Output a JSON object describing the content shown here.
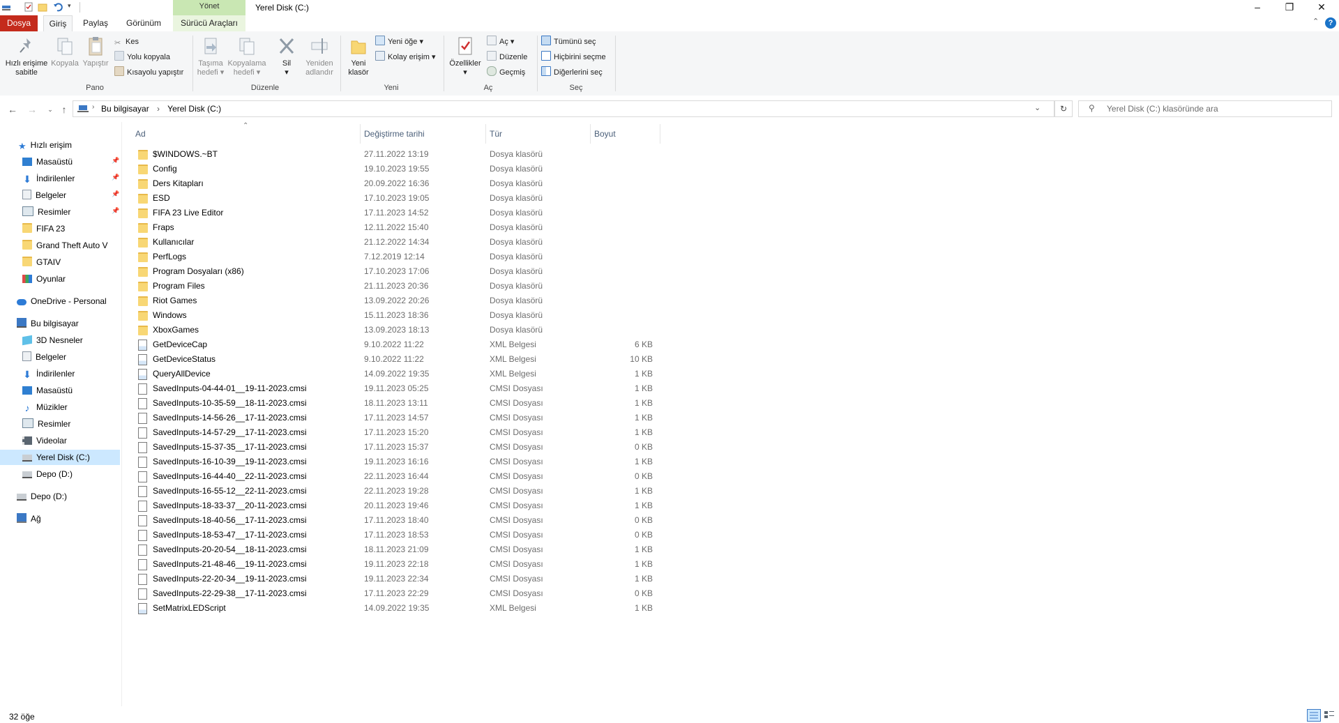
{
  "window": {
    "title": "Yerel Disk (C:)",
    "context_tab_group": "Yönet"
  },
  "tabs": {
    "file": "Dosya",
    "home": "Giriş",
    "share": "Paylaş",
    "view": "Görünüm",
    "drive_tools": "Sürücü Araçları"
  },
  "ribbon": {
    "clipboard": {
      "pin": "Hızlı erişime sabitle",
      "copy": "Kopyala",
      "paste": "Yapıştır",
      "cut": "Kes",
      "copy_path": "Yolu kopyala",
      "paste_shortcut": "Kısayolu yapıştır",
      "label": "Pano"
    },
    "organize": {
      "move_to": "Taşıma hedefi",
      "copy_to": "Kopyalama hedefi",
      "delete": "Sil",
      "rename": "Yeniden adlandır",
      "label": "Düzenle"
    },
    "new": {
      "new_folder": "Yeni klasör",
      "new_item": "Yeni öğe",
      "easy_access": "Kolay erişim",
      "label": "Yeni"
    },
    "open": {
      "properties": "Özellikler",
      "open": "Aç",
      "edit": "Düzenle",
      "history": "Geçmiş",
      "label": "Aç"
    },
    "select": {
      "select_all": "Tümünü seç",
      "select_none": "Hiçbirini seçme",
      "invert": "Diğerlerini seç",
      "label": "Seç"
    }
  },
  "address": {
    "crumb1": "Bu bilgisayar",
    "crumb2": "Yerel Disk (C:)",
    "search_placeholder": "Yerel Disk (C:) klasöründe ara"
  },
  "sidebar": {
    "quick_access": "Hızlı erişim",
    "quick_items": [
      "Masaüstü",
      "İndirilenler",
      "Belgeler",
      "Resimler",
      "FIFA 23",
      "Grand Theft Auto V",
      "GTAIV",
      "Oyunlar"
    ],
    "onedrive": "OneDrive - Personal",
    "this_pc": "Bu bilgisayar",
    "pc_items": [
      "3D Nesneler",
      "Belgeler",
      "İndirilenler",
      "Masaüstü",
      "Müzikler",
      "Resimler",
      "Videolar",
      "Yerel Disk (C:)",
      "Depo (D:)"
    ],
    "depo": "Depo (D:)",
    "network": "Ağ"
  },
  "columns": {
    "name": "Ad",
    "modified": "Değiştirme tarihi",
    "type": "Tür",
    "size": "Boyut"
  },
  "files": [
    {
      "name": "$WINDOWS.~BT",
      "date": "27.11.2022 13:19",
      "type": "Dosya klasörü",
      "size": "",
      "kind": "folder"
    },
    {
      "name": "Config",
      "date": "19.10.2023 19:55",
      "type": "Dosya klasörü",
      "size": "",
      "kind": "folder"
    },
    {
      "name": "Ders Kitapları",
      "date": "20.09.2022 16:36",
      "type": "Dosya klasörü",
      "size": "",
      "kind": "folder"
    },
    {
      "name": "ESD",
      "date": "17.10.2023 19:05",
      "type": "Dosya klasörü",
      "size": "",
      "kind": "folder"
    },
    {
      "name": "FIFA 23 Live Editor",
      "date": "17.11.2023 14:52",
      "type": "Dosya klasörü",
      "size": "",
      "kind": "folder"
    },
    {
      "name": "Fraps",
      "date": "12.11.2022 15:40",
      "type": "Dosya klasörü",
      "size": "",
      "kind": "folder"
    },
    {
      "name": "Kullanıcılar",
      "date": "21.12.2022 14:34",
      "type": "Dosya klasörü",
      "size": "",
      "kind": "folder"
    },
    {
      "name": "PerfLogs",
      "date": "7.12.2019 12:14",
      "type": "Dosya klasörü",
      "size": "",
      "kind": "folder"
    },
    {
      "name": "Program Dosyaları (x86)",
      "date": "17.10.2023 17:06",
      "type": "Dosya klasörü",
      "size": "",
      "kind": "folder"
    },
    {
      "name": "Program Files",
      "date": "21.11.2023 20:36",
      "type": "Dosya klasörü",
      "size": "",
      "kind": "folder"
    },
    {
      "name": "Riot Games",
      "date": "13.09.2022 20:26",
      "type": "Dosya klasörü",
      "size": "",
      "kind": "folder"
    },
    {
      "name": "Windows",
      "date": "15.11.2023 18:36",
      "type": "Dosya klasörü",
      "size": "",
      "kind": "folder"
    },
    {
      "name": "XboxGames",
      "date": "13.09.2023 18:13",
      "type": "Dosya klasörü",
      "size": "",
      "kind": "folder"
    },
    {
      "name": "GetDeviceCap",
      "date": "9.10.2022 11:22",
      "type": "XML Belgesi",
      "size": "6 KB",
      "kind": "xml"
    },
    {
      "name": "GetDeviceStatus",
      "date": "9.10.2022 11:22",
      "type": "XML Belgesi",
      "size": "10 KB",
      "kind": "xml"
    },
    {
      "name": "QueryAllDevice",
      "date": "14.09.2022 19:35",
      "type": "XML Belgesi",
      "size": "1 KB",
      "kind": "xml"
    },
    {
      "name": "SavedInputs-04-44-01__19-11-2023.cmsi",
      "date": "19.11.2023 05:25",
      "type": "CMSI Dosyası",
      "size": "1 KB",
      "kind": "doc"
    },
    {
      "name": "SavedInputs-10-35-59__18-11-2023.cmsi",
      "date": "18.11.2023 13:11",
      "type": "CMSI Dosyası",
      "size": "1 KB",
      "kind": "doc"
    },
    {
      "name": "SavedInputs-14-56-26__17-11-2023.cmsi",
      "date": "17.11.2023 14:57",
      "type": "CMSI Dosyası",
      "size": "1 KB",
      "kind": "doc"
    },
    {
      "name": "SavedInputs-14-57-29__17-11-2023.cmsi",
      "date": "17.11.2023 15:20",
      "type": "CMSI Dosyası",
      "size": "1 KB",
      "kind": "doc"
    },
    {
      "name": "SavedInputs-15-37-35__17-11-2023.cmsi",
      "date": "17.11.2023 15:37",
      "type": "CMSI Dosyası",
      "size": "0 KB",
      "kind": "doc"
    },
    {
      "name": "SavedInputs-16-10-39__19-11-2023.cmsi",
      "date": "19.11.2023 16:16",
      "type": "CMSI Dosyası",
      "size": "1 KB",
      "kind": "doc"
    },
    {
      "name": "SavedInputs-16-44-40__22-11-2023.cmsi",
      "date": "22.11.2023 16:44",
      "type": "CMSI Dosyası",
      "size": "0 KB",
      "kind": "doc"
    },
    {
      "name": "SavedInputs-16-55-12__22-11-2023.cmsi",
      "date": "22.11.2023 19:28",
      "type": "CMSI Dosyası",
      "size": "1 KB",
      "kind": "doc"
    },
    {
      "name": "SavedInputs-18-33-37__20-11-2023.cmsi",
      "date": "20.11.2023 19:46",
      "type": "CMSI Dosyası",
      "size": "1 KB",
      "kind": "doc"
    },
    {
      "name": "SavedInputs-18-40-56__17-11-2023.cmsi",
      "date": "17.11.2023 18:40",
      "type": "CMSI Dosyası",
      "size": "0 KB",
      "kind": "doc"
    },
    {
      "name": "SavedInputs-18-53-47__17-11-2023.cmsi",
      "date": "17.11.2023 18:53",
      "type": "CMSI Dosyası",
      "size": "0 KB",
      "kind": "doc"
    },
    {
      "name": "SavedInputs-20-20-54__18-11-2023.cmsi",
      "date": "18.11.2023 21:09",
      "type": "CMSI Dosyası",
      "size": "1 KB",
      "kind": "doc"
    },
    {
      "name": "SavedInputs-21-48-46__19-11-2023.cmsi",
      "date": "19.11.2023 22:18",
      "type": "CMSI Dosyası",
      "size": "1 KB",
      "kind": "doc"
    },
    {
      "name": "SavedInputs-22-20-34__19-11-2023.cmsi",
      "date": "19.11.2023 22:34",
      "type": "CMSI Dosyası",
      "size": "1 KB",
      "kind": "doc"
    },
    {
      "name": "SavedInputs-22-29-38__17-11-2023.cmsi",
      "date": "17.11.2023 22:29",
      "type": "CMSI Dosyası",
      "size": "0 KB",
      "kind": "doc"
    },
    {
      "name": "SetMatrixLEDScript",
      "date": "14.09.2022 19:35",
      "type": "XML Belgesi",
      "size": "1 KB",
      "kind": "xml"
    }
  ],
  "status": {
    "count": "32 öğe"
  },
  "colors": {
    "file_tab": "#c42b1c",
    "manage_tab": "#c9e7b3",
    "selection": "#cce8ff",
    "folder": "#f8d775"
  }
}
